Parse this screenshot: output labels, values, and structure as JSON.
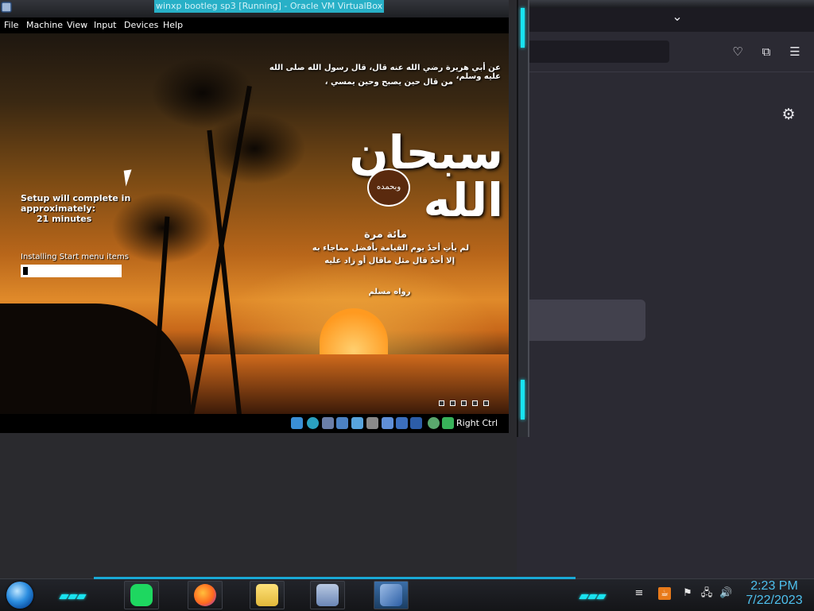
{
  "vbox": {
    "title": "winxp bootleg sp3 [Running] - Oracle VM VirtualBox",
    "menu": [
      "File",
      "Machine",
      "View",
      "Input",
      "Devices",
      "Help"
    ],
    "host_key": "Right Ctrl",
    "status_icons": [
      "optical-drive-icon",
      "network-icon",
      "usb-icon",
      "shared-folders-icon",
      "display-icon",
      "pen-icon",
      "hard-disk-icon",
      "screen-icon",
      "window-icon",
      "vbox-v-icon",
      "processor-icon",
      "arrow-down-icon"
    ]
  },
  "guest": {
    "setup": {
      "line1": "Setup will complete in",
      "line2": "approximately:",
      "line3": "21 minutes"
    },
    "status": "Installing Start menu items",
    "progress": 0.05,
    "arabic": {
      "top1": "عن أبي هريرة رضي الله عنه قال، قال رسول الله صلى الله عليه وسلم،",
      "top2": "من قال حين يصبح وحين يمسي ،",
      "calligraphy": "سبحان الله",
      "seal": "وبحمده",
      "hundred": "مائة مرة",
      "line1": "لم يأتِ أحدٌ يوم القيامة بأفضل مماجاء به",
      "line2": "إلا أحدٌ قال مثل ماقال أو زاد عليه",
      "source": "رواه مسلم"
    }
  },
  "browser": {
    "icons": [
      "tab-list-icon",
      "pocket-icon",
      "extensions-icon",
      "menu-icon",
      "settings-icon"
    ]
  },
  "taskbar": {
    "apps": [
      "spotify-icon",
      "firefox-icon",
      "file-manager-icon",
      "virtualbox-icon",
      "winxp-vm-icon"
    ],
    "tray": [
      "network-monitor-icon",
      "java-icon",
      "flag-icon",
      "network-icon",
      "volume-icon"
    ],
    "clock": {
      "time": "2:23 PM",
      "date": "7/22/2023"
    }
  },
  "colors": {
    "accent": "#19e3f0",
    "title_highlight": "#28b0c7",
    "clock": "#4ec0ee"
  }
}
